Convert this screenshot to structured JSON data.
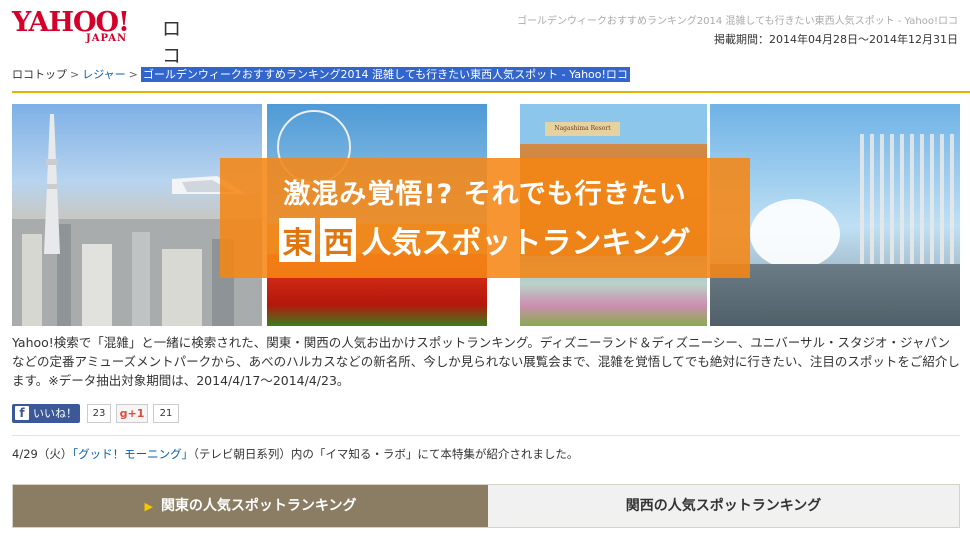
{
  "header": {
    "logo_text": "YAHOO!",
    "logo_sub": "JAPAN",
    "logo_service": "ロコ",
    "page_title": "ゴールデンウィークおすすめランキング2014 混雑しても行きたい東西人気スポット - Yahoo!ロコ",
    "period": "掲載期間：2014年04月28日～2014年12月31日"
  },
  "breadcrumb": {
    "items": [
      "ロコトップ",
      "レジャー"
    ],
    "separator": ">",
    "current": "ゴールデンウィークおすすめランキング2014 混雑しても行きたい東西人気スポット - Yahoo!ロコ"
  },
  "hero": {
    "line1": "激混み覚悟!?  それでも行きたい",
    "box1": "東",
    "box2": "西",
    "line2_rest": "人気スポットランキング",
    "photo3_sign": "Nagashima Resort"
  },
  "intro": "Yahoo!検索で「混雑」と一緒に検索された、関東・関西の人気お出かけスポットランキング。ディズニーランド＆ディズニーシー、ユニバーサル・スタジオ・ジャパンなどの定番アミューズメントパークから、あべのハルカスなどの新名所、今しか見られない展覧会まで、混雑を覚悟してでも絶対に行きたい、注目のスポットをご紹介します。※データ抽出対象期間は、2014/4/17～2014/4/23。",
  "social": {
    "fb_icon": "f",
    "fb_label": "いいね！",
    "fb_count": "23",
    "gplus_label": "g+1",
    "gplus_count": "21"
  },
  "note": {
    "date": "4/29（火）",
    "link": "「グッド！モーニング」",
    "rest": "（テレビ朝日系列）内の「イマ知る・ラボ」にて本特集が紹介されました。"
  },
  "tabs": {
    "kanto_icon": "▶",
    "kanto": "関東の人気スポットランキング",
    "kansai": "関西の人気スポットランキング"
  },
  "colors": {
    "brand_red": "#d4002a",
    "accent_orange": "#f58614",
    "rule_gold": "#e0b400",
    "tab_active": "#8a7d64",
    "link_blue": "#0a5fb0"
  }
}
